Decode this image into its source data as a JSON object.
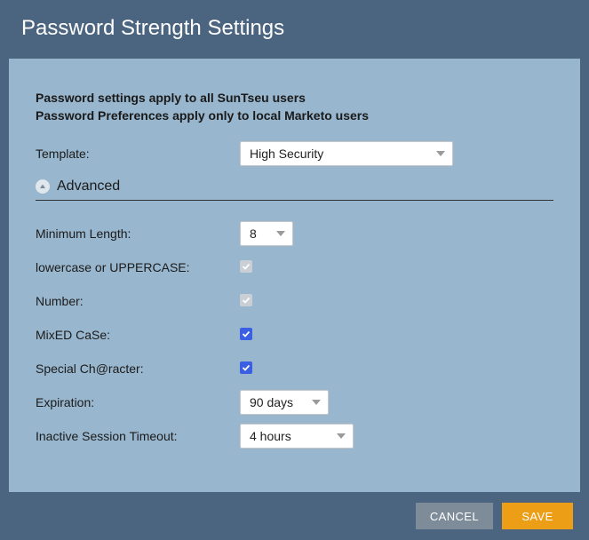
{
  "dialog": {
    "title": "Password Strength Settings",
    "intro_line1": "Password settings apply to all SunTseu users",
    "intro_line2": "Password Preferences apply only to local Marketo users"
  },
  "template": {
    "label": "Template:",
    "value": "High Security"
  },
  "advanced": {
    "header": "Advanced",
    "fields": {
      "min_length": {
        "label": "Minimum Length:",
        "value": "8"
      },
      "case_or": {
        "label": "lowercase or UPPERCASE:",
        "checked": true,
        "disabled": true
      },
      "number": {
        "label": "Number:",
        "checked": true,
        "disabled": true
      },
      "mixed_case": {
        "label": "MixED CaSe:",
        "checked": true,
        "disabled": false
      },
      "special_char": {
        "label": "Special Ch@racter:",
        "checked": true,
        "disabled": false
      },
      "expiration": {
        "label": "Expiration:",
        "value": "90 days"
      },
      "timeout": {
        "label": "Inactive Session Timeout:",
        "value": "4 hours"
      }
    }
  },
  "actions": {
    "cancel": "CANCEL",
    "save": "SAVE"
  }
}
